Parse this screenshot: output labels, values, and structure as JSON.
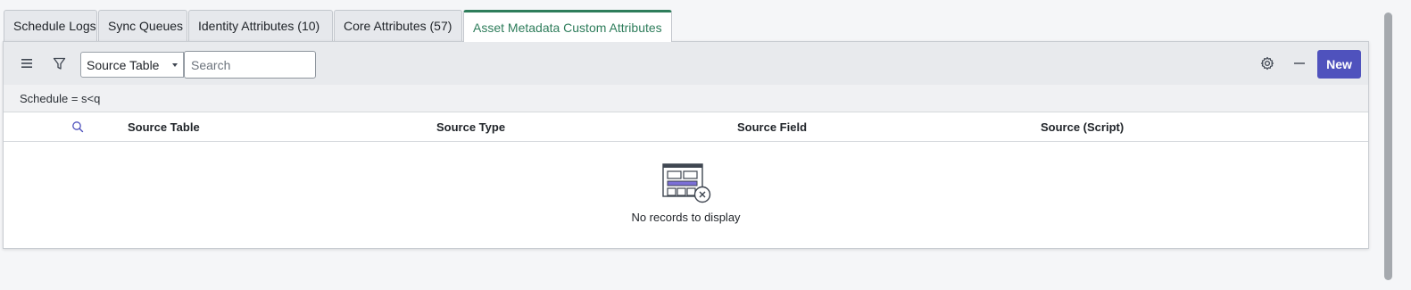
{
  "tabs": [
    {
      "label": "Schedule Logs"
    },
    {
      "label": "Sync Queues"
    },
    {
      "label": "Identity Attributes (10)"
    },
    {
      "label": "Core Attributes (57)"
    },
    {
      "label": "Asset Metadata Custom Attributes",
      "active": true
    }
  ],
  "toolbar": {
    "menu_icon": "hamburger-icon",
    "filter_icon": "funnel-icon",
    "field_select": {
      "value": "Source Table"
    },
    "search": {
      "placeholder": "Search",
      "value": ""
    },
    "settings_icon": "gear-icon",
    "minimize_icon": "minus-icon",
    "new_label": "New"
  },
  "breadcrumb": {
    "text": "Schedule = s<q"
  },
  "table": {
    "columns": [
      "Source Table",
      "Source Type",
      "Source Field",
      "Source (Script)"
    ],
    "rows": []
  },
  "empty_state": {
    "message": "No records to display",
    "icon": "empty-table-icon"
  },
  "colors": {
    "accent": "#2e7d5b",
    "primary_button": "#4f52bd",
    "illustration": "#7b6fd6"
  }
}
